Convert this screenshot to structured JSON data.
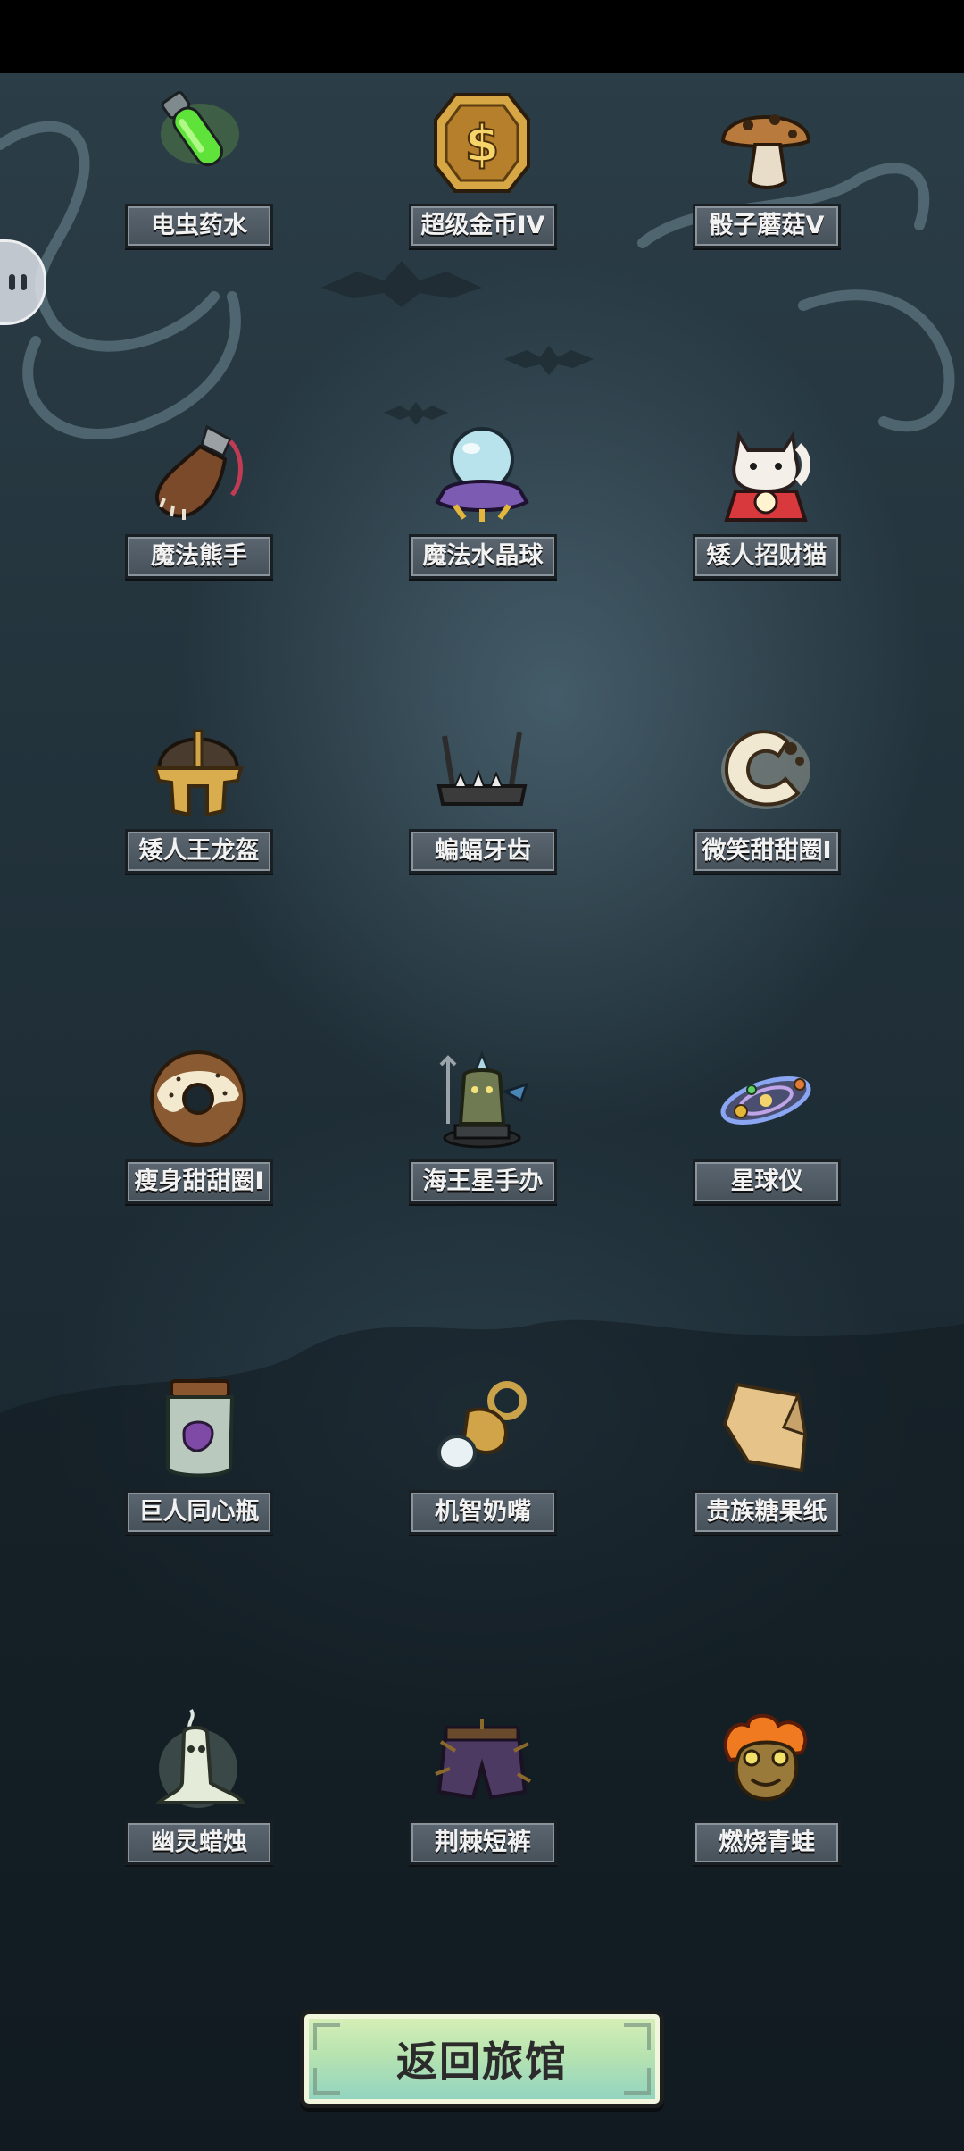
{
  "collection": {
    "items": [
      {
        "label": "电虫药水",
        "icon": "green-potion-vial-icon"
      },
      {
        "label": "超级金币IV",
        "icon": "gold-coin-icon"
      },
      {
        "label": "骰子蘑菇V",
        "icon": "dice-mushroom-icon"
      },
      {
        "label": "魔法熊手",
        "icon": "bear-paw-icon"
      },
      {
        "label": "魔法水晶球",
        "icon": "crystal-ball-icon"
      },
      {
        "label": "矮人招财猫",
        "icon": "lucky-cat-icon"
      },
      {
        "label": "矮人王龙盔",
        "icon": "dwarf-helmet-icon"
      },
      {
        "label": "蝙蝠牙齿",
        "icon": "bat-teeth-icon"
      },
      {
        "label": "微笑甜甜圈I",
        "icon": "smile-donut-icon"
      },
      {
        "label": "瘦身甜甜圈I",
        "icon": "donut-icon"
      },
      {
        "label": "海王星手办",
        "icon": "neptune-figure-icon"
      },
      {
        "label": "星球仪",
        "icon": "orrery-icon"
      },
      {
        "label": "巨人同心瓶",
        "icon": "jar-icon"
      },
      {
        "label": "机智奶嘴",
        "icon": "pacifier-icon"
      },
      {
        "label": "贵族糖果纸",
        "icon": "candy-wrapper-icon"
      },
      {
        "label": "幽灵蜡烛",
        "icon": "ghost-candle-icon"
      },
      {
        "label": "荆棘短裤",
        "icon": "thorn-shorts-icon"
      },
      {
        "label": "燃烧青蛙",
        "icon": "burning-frog-icon"
      }
    ]
  },
  "footer": {
    "return_label": "返回旅馆"
  }
}
